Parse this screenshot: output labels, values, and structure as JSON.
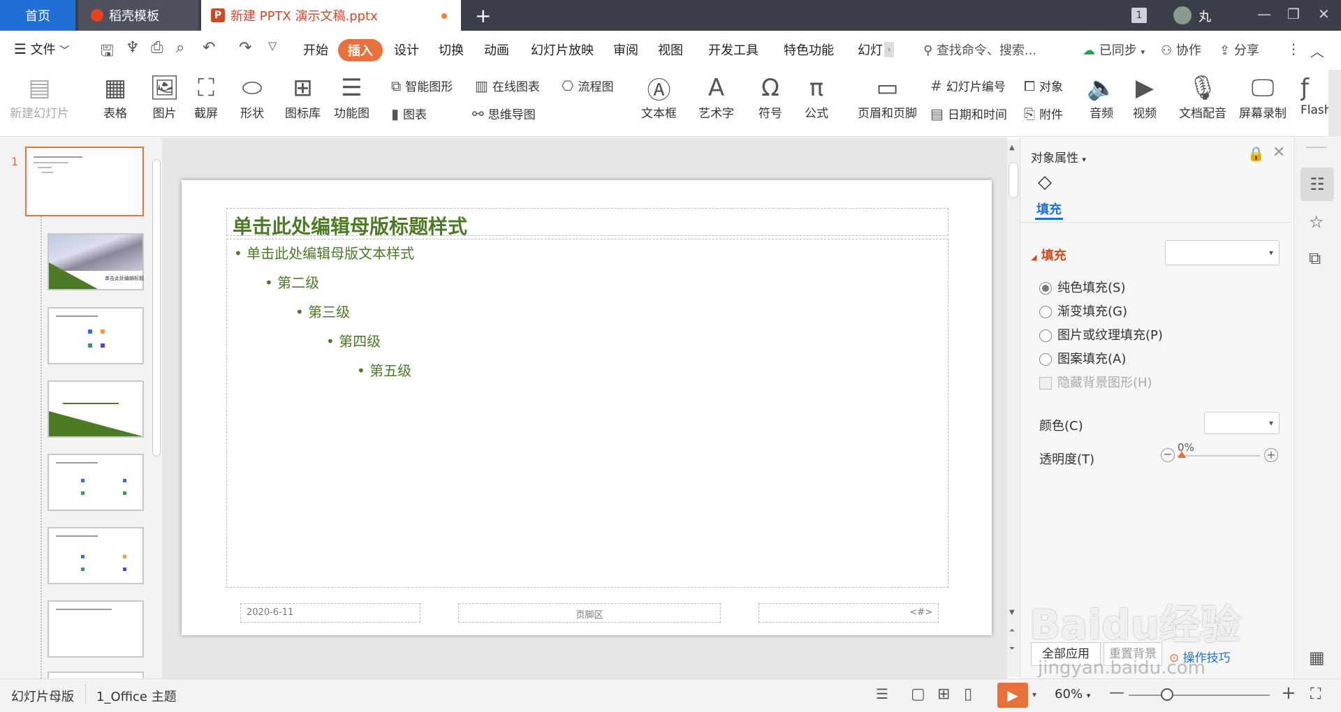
{
  "tabs": {
    "home": "首页",
    "docer": "稻壳模板",
    "document": "新建 PPTX 演示文稿.pptx",
    "badge": "1",
    "user": "丸"
  },
  "menu": {
    "file": "文件",
    "items": [
      "开始",
      "插入",
      "设计",
      "切换",
      "动画",
      "幻灯片放映",
      "审阅",
      "视图",
      "开发工具",
      "特色功能",
      "幻灯片"
    ],
    "search": "查找命令、搜索...",
    "sync": "已同步",
    "collab": "协作",
    "share": "分享"
  },
  "ribbon": {
    "new_slide": "新建幻灯片",
    "table": "表格",
    "picture": "图片",
    "screenshot": "截屏",
    "shape": "形状",
    "icon_lib": "图标库",
    "func_chart": "功能图",
    "smart_shape": "智能图形",
    "online_chart": "在线图表",
    "chart": "图表",
    "flowchart": "流程图",
    "mindmap": "思维导图",
    "textbox": "文本框",
    "wordart": "艺术字",
    "symbol": "符号",
    "formula": "公式",
    "header_footer": "页眉和页脚",
    "slide_number": "幻灯片编号",
    "object": "对象",
    "datetime": "日期和时间",
    "attachment": "附件",
    "audio": "音频",
    "video": "视频",
    "narration": "文档配音",
    "screen_record": "屏幕录制",
    "flash": "Flash"
  },
  "slide": {
    "title": "单击此处编辑母版标题样式",
    "levels": [
      "单击此处编辑母版文本样式",
      "第二级",
      "第三级",
      "第四级",
      "第五级"
    ],
    "date": "2020-6-11",
    "footer": "页脚区",
    "number": "<#>"
  },
  "thumbs": {
    "first_number": "1",
    "second_title": "单击此处编辑标题"
  },
  "props": {
    "title": "对象属性",
    "tab": "填充",
    "section": "填充",
    "options": [
      "纯色填充(S)",
      "渐变填充(G)",
      "图片或纹理填充(P)",
      "图案填充(A)"
    ],
    "hide_bg": "隐藏背景图形(H)",
    "color": "颜色(C)",
    "transparency": "透明度(T)",
    "transparency_value": "0%",
    "apply_all": "全部应用",
    "reset_bg": "重置背景",
    "tips": "操作技巧"
  },
  "status": {
    "mode": "幻灯片母版",
    "theme": "1_Office 主题",
    "zoom": "60%"
  },
  "watermark": {
    "brand": "Baidu经验",
    "url": "jingyan.baidu.com"
  },
  "colors": {
    "accent": "#e8703a",
    "titlebar": "#3b3f4a",
    "home_tab": "#1f6fd6",
    "slide_text": "#4d7a25"
  }
}
